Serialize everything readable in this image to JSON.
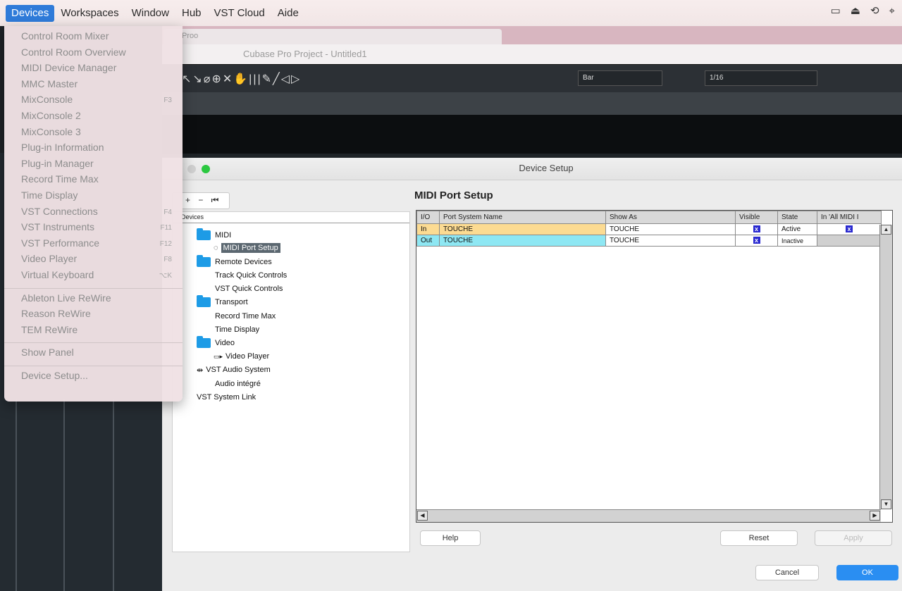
{
  "menubar": {
    "items": [
      "Devices",
      "Workspaces",
      "Window",
      "Hub",
      "VST Cloud",
      "Aide"
    ],
    "tray": [
      "▭",
      "⏏",
      "⟲",
      "⌖"
    ]
  },
  "background": {
    "tab_label": "Proo",
    "window_title": "Cubase Pro Project - Untitled1",
    "toolbar": {
      "tools": "↖↘⌀⊕✕✋|||✎╱◁▷",
      "snap_type": "Bar",
      "quantize": "1/16"
    }
  },
  "devices_menu": {
    "group1": [
      {
        "label": "Control Room Mixer",
        "shortcut": ""
      },
      {
        "label": "Control Room Overview",
        "shortcut": ""
      },
      {
        "label": "MIDI Device Manager",
        "shortcut": ""
      },
      {
        "label": "MMC Master",
        "shortcut": ""
      },
      {
        "label": "MixConsole",
        "shortcut": "F3"
      },
      {
        "label": "MixConsole 2",
        "shortcut": ""
      },
      {
        "label": "MixConsole 3",
        "shortcut": ""
      },
      {
        "label": "Plug-in Information",
        "shortcut": ""
      },
      {
        "label": "Plug-in Manager",
        "shortcut": ""
      },
      {
        "label": "Record Time Max",
        "shortcut": ""
      },
      {
        "label": "Time Display",
        "shortcut": ""
      },
      {
        "label": "VST Connections",
        "shortcut": "F4"
      },
      {
        "label": "VST Instruments",
        "shortcut": "F11"
      },
      {
        "label": "VST Performance",
        "shortcut": "F12"
      },
      {
        "label": "Video Player",
        "shortcut": "F8"
      },
      {
        "label": "Virtual Keyboard",
        "shortcut": "⌥K"
      }
    ],
    "group2": [
      "Ableton Live ReWire",
      "Reason ReWire",
      "TEM ReWire"
    ],
    "group3": [
      "Show Panel"
    ],
    "group4": [
      "Device Setup..."
    ]
  },
  "dialog": {
    "title": "Device Setup",
    "tree_tools": "+ − ⏮",
    "tree_header": "Devices",
    "tree": [
      {
        "label": "MIDI",
        "icon": "folder"
      },
      {
        "label": "MIDI Port Setup",
        "icon": "midi-port",
        "selected": true
      },
      {
        "label": "Remote Devices",
        "icon": "folder"
      },
      {
        "label": "Track Quick Controls",
        "icon": ""
      },
      {
        "label": "VST Quick Controls",
        "icon": ""
      },
      {
        "label": "Transport",
        "icon": "folder"
      },
      {
        "label": "Record Time Max",
        "icon": ""
      },
      {
        "label": "Time Display",
        "icon": ""
      },
      {
        "label": "Video",
        "icon": "folder"
      },
      {
        "label": "Video Player",
        "icon": "video"
      },
      {
        "label": "VST Audio System",
        "icon": "audio-system"
      },
      {
        "label": "Audio intégré",
        "icon": ""
      },
      {
        "label": "VST System Link",
        "icon": ""
      }
    ],
    "panel_title": "MIDI Port Setup",
    "columns": [
      "I/O",
      "Port System Name",
      "Show As",
      "Visible",
      "State",
      "In 'All MIDI I"
    ],
    "rows": [
      {
        "io": "In",
        "port": "TOUCHE",
        "show_as": "TOUCHE",
        "visible": "x",
        "state": "Active",
        "all_midi": "x"
      },
      {
        "io": "Out",
        "port": "TOUCHE",
        "show_as": "TOUCHE",
        "visible": "x",
        "state": "Inactive",
        "all_midi": ""
      }
    ],
    "buttons": {
      "help": "Help",
      "reset": "Reset",
      "apply": "Apply",
      "cancel": "Cancel",
      "ok": "OK"
    }
  }
}
